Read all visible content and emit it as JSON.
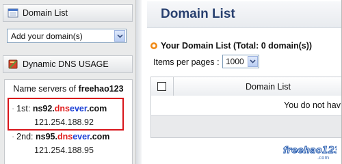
{
  "sidebar": {
    "domain_list_label": "Domain List",
    "add_domain_select": "Add your domain(s)",
    "ddns_label": "Dynamic DNS USAGE",
    "name_servers": {
      "title_prefix": "Name servers of ",
      "title_user": "freehao123",
      "items": [
        {
          "index": "1st:",
          "host_a": "ns92.",
          "host_red": "dns",
          "host_blue": "ever",
          "host_b": ".com",
          "ip": "121.254.188.92"
        },
        {
          "index": "2nd:",
          "host_a": "ns95.",
          "host_red": "dns",
          "host_blue": "ever",
          "host_b": ".com",
          "ip": "121.254.188.95"
        }
      ]
    }
  },
  "main": {
    "title": "Domain List",
    "list_heading": "Your Domain List (Total: 0 domain(s))",
    "items_per_page_label": "Items per pages :",
    "items_per_page_value": "1000",
    "table": {
      "header_label": "Domain List",
      "empty_message": "You do not hav"
    },
    "watermark": "freehao123"
  },
  "colors": {
    "title_blue": "#28406f",
    "dns_red": "#e01b1b",
    "ever_blue": "#1a3fd6",
    "highlight_red": "#d8141a",
    "bullet_orange": "#f08a16"
  }
}
